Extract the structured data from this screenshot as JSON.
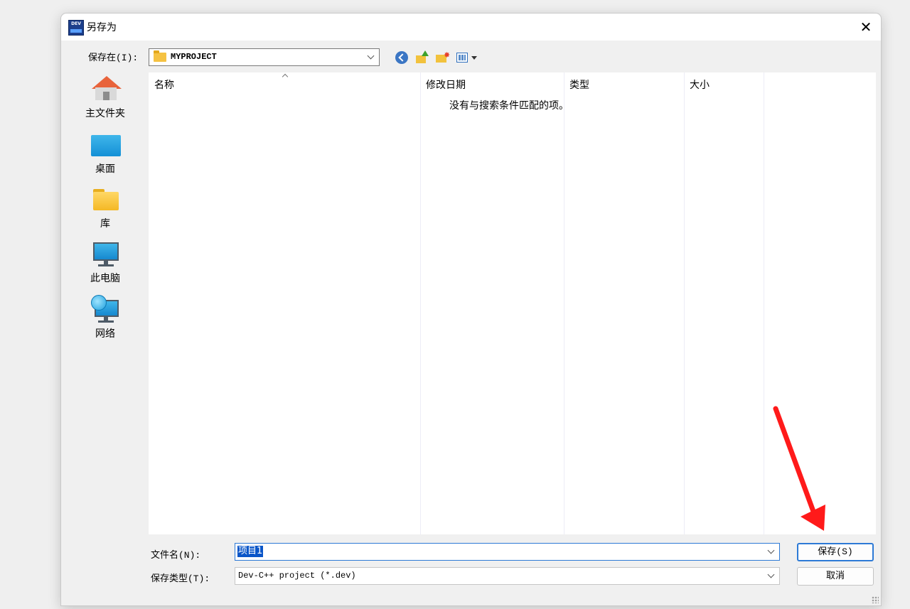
{
  "window": {
    "title": "另存为",
    "app_icon": "DEV",
    "close_glyph": "✕"
  },
  "save_in": {
    "label": "保存在(I):",
    "path": "MYPROJECT"
  },
  "toolbar": {
    "icons": [
      "back-icon",
      "up-folder-icon",
      "new-folder-icon",
      "view-menu-icon"
    ]
  },
  "places": [
    {
      "label": "主文件夹",
      "icon": "home-icon"
    },
    {
      "label": "桌面",
      "icon": "desktop-icon"
    },
    {
      "label": "库",
      "icon": "library-folder-icon"
    },
    {
      "label": "此电脑",
      "icon": "computer-icon"
    },
    {
      "label": "网络",
      "icon": "network-icon"
    }
  ],
  "file_list": {
    "columns": [
      "名称",
      "修改日期",
      "类型",
      "大小"
    ],
    "empty_message": "没有与搜索条件匹配的项。"
  },
  "filename": {
    "label": "文件名(N):",
    "value": "项目1"
  },
  "filetype": {
    "label": "保存类型(T):",
    "value": "Dev-C++ project (*.dev)"
  },
  "buttons": {
    "save": "保存(S)",
    "cancel": "取消"
  },
  "colors": {
    "accent": "#2d7ad6",
    "annotation_arrow": "#ff1a1a"
  }
}
